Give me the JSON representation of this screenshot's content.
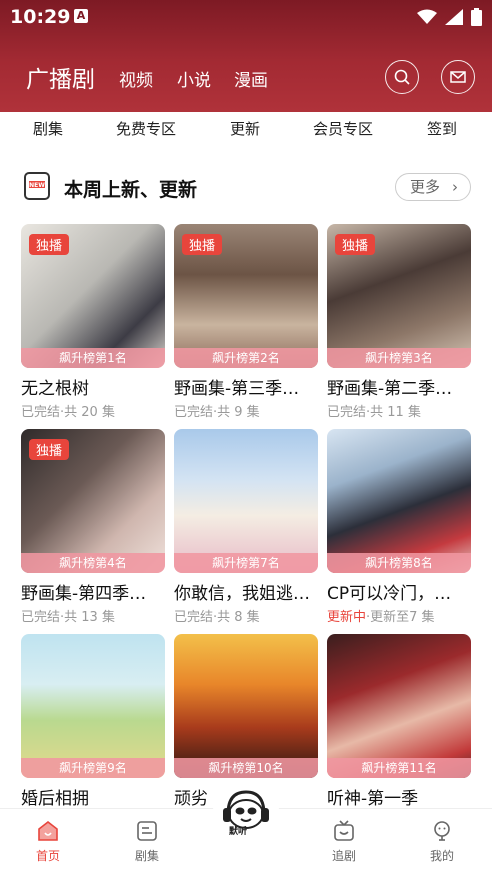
{
  "status": {
    "time": "10:29"
  },
  "nav": {
    "main": "广播剧",
    "items": [
      "视频",
      "小说",
      "漫画"
    ]
  },
  "categories": [
    "剧集",
    "免费专区",
    "更新",
    "会员专区",
    "签到"
  ],
  "section": {
    "title": "本周上新、更新",
    "more": "更多"
  },
  "cards": [
    {
      "title": "无之根树",
      "rank": "飙升榜第1名",
      "badge": "独播",
      "info_a": "已完结",
      "info_b": "·共 20 集"
    },
    {
      "title": "野画集-第三季…",
      "rank": "飙升榜第2名",
      "badge": "独播",
      "info_a": "已完结",
      "info_b": "·共 9 集"
    },
    {
      "title": "野画集-第二季…",
      "rank": "飙升榜第3名",
      "badge": "独播",
      "info_a": "已完结",
      "info_b": "·共 11 集"
    },
    {
      "title": "野画集-第四季…",
      "rank": "飙升榜第4名",
      "badge": "独播",
      "info_a": "已完结",
      "info_b": "·共 13 集"
    },
    {
      "title": "你敢信，我姐逃…",
      "rank": "飙升榜第7名",
      "badge": "",
      "info_a": "已完结",
      "info_b": "·共 8 集"
    },
    {
      "title": "CP可以冷门，…",
      "rank": "飙升榜第8名",
      "badge": "",
      "info_a": "更新中",
      "info_b": "·更新至7 集",
      "highlight": true
    },
    {
      "title": "婚后相拥",
      "rank": "飙升榜第9名",
      "badge": "",
      "info_a": "",
      "info_b": ""
    },
    {
      "title": "顽劣",
      "rank": "飙升榜第10名",
      "badge": "",
      "info_a": "",
      "info_b": ""
    },
    {
      "title": "听神-第一季",
      "rank": "飙升榜第11名",
      "badge": "",
      "info_a": "",
      "info_b": ""
    }
  ],
  "tabs": [
    "首页",
    "剧集",
    "追剧",
    "我的"
  ],
  "center": {
    "label": "默听"
  },
  "colors": {
    "header": "#9e2630",
    "accent": "#e8453c",
    "rank_band": "#f096a0"
  }
}
